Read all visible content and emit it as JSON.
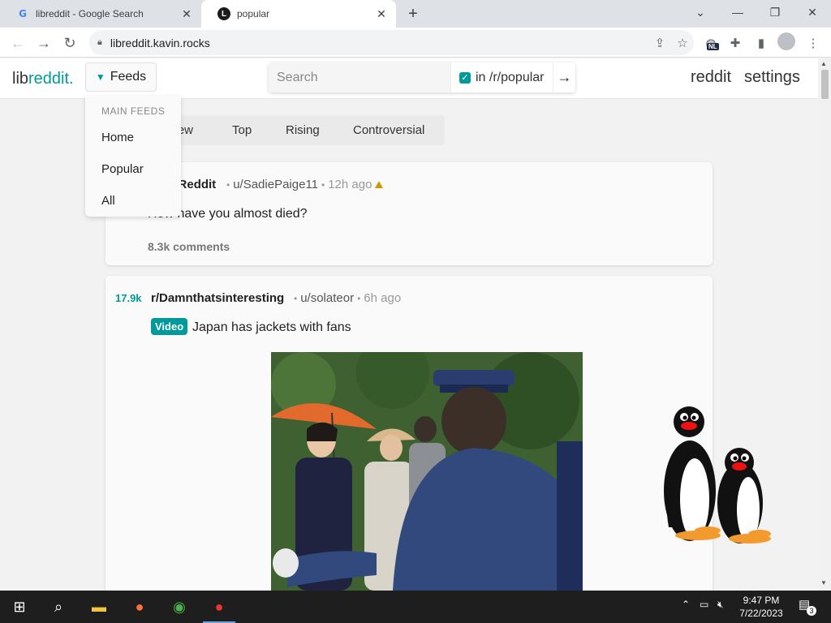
{
  "browser": {
    "tabs": [
      {
        "title": "libreddit - Google Search",
        "favicon": "G",
        "active": false
      },
      {
        "title": "popular",
        "favicon": "L",
        "active": true
      }
    ],
    "new_tab_label": "+",
    "url": "libreddit.kavin.rocks",
    "extension_badge": "NL"
  },
  "header": {
    "logo_lib": "lib",
    "logo_reddit": "reddit.",
    "feeds_label": "Feeds",
    "search_placeholder": "Search",
    "restrict_label": "in /r/popular",
    "reddit_link": "reddit",
    "settings_link": "settings"
  },
  "dropdown": {
    "heading": "MAIN FEEDS",
    "items": [
      "Home",
      "Popular",
      "All"
    ]
  },
  "sort": {
    "items": [
      "New",
      "Top",
      "Rising",
      "Controversial"
    ]
  },
  "posts": [
    {
      "subreddit": "AskReddit",
      "author": "u/SadiePaige11",
      "time": "12h ago",
      "title": "How have you almost died?",
      "comments": "8.3k comments"
    },
    {
      "score": "17.9k",
      "subreddit": "r/Damnthatsinteresting",
      "author": "u/solateor",
      "time": "6h ago",
      "flair": "Video",
      "title": "Japan has jackets with fans"
    }
  ],
  "taskbar": {
    "time": "9:47 PM",
    "date": "7/22/2023",
    "notifications": "3"
  },
  "colors": {
    "accent": "#009a9a",
    "background": "#f2f2f2",
    "card": "#fafafa"
  }
}
